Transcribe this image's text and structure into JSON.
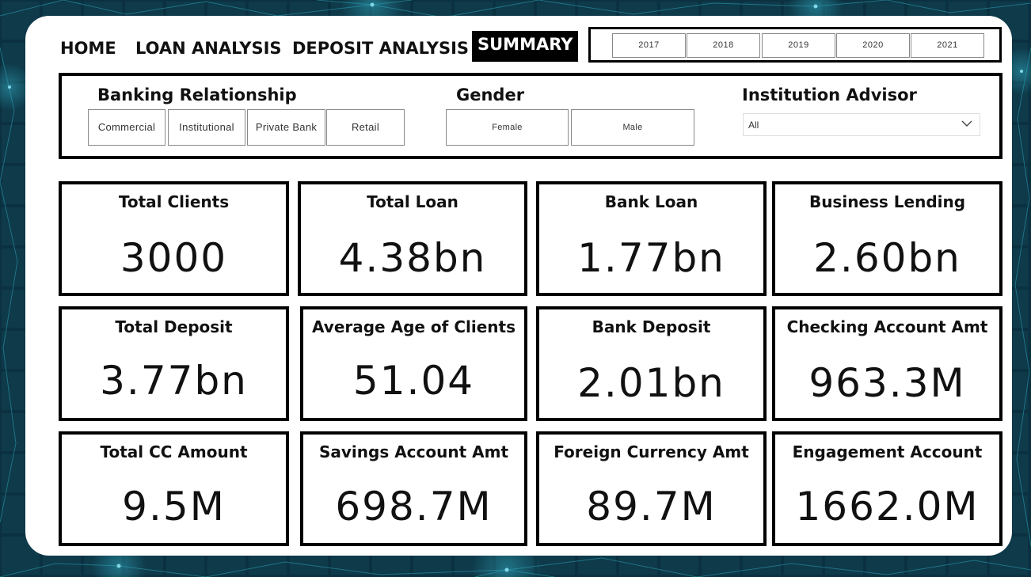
{
  "nav": {
    "home": "HOME",
    "loan_analysis": "LOAN ANALYSIS",
    "deposit_analysis": "DEPOSIT ANALYSIS",
    "summary": "SUMMARY"
  },
  "years": [
    "2017",
    "2018",
    "2019",
    "2020",
    "2021"
  ],
  "filters": {
    "banking_relationship": {
      "title": "Banking Relationship",
      "options": [
        "Commercial",
        "Institutional",
        "Private Bank",
        "Retail"
      ]
    },
    "gender": {
      "title": "Gender",
      "options": [
        "Female",
        "Male"
      ]
    },
    "institution_advisor": {
      "title": "Institution Advisor",
      "value": "All",
      "icon": "chevron-down-icon"
    }
  },
  "kpis": [
    {
      "title": "Total Clients",
      "value": "3000"
    },
    {
      "title": "Total Loan",
      "value": "4.38bn"
    },
    {
      "title": "Bank Loan",
      "value": "1.77bn"
    },
    {
      "title": "Business Lending",
      "value": "2.60bn"
    },
    {
      "title": "Total Deposit",
      "value": "3.77bn"
    },
    {
      "title": "Average Age of Clients",
      "value": "51.04"
    },
    {
      "title": "Bank Deposit",
      "value": "2.01bn"
    },
    {
      "title": "Checking Account Amt",
      "value": "963.3M"
    },
    {
      "title": "Total CC Amount",
      "value": "9.5M"
    },
    {
      "title": "Savings Account Amt",
      "value": "698.7M"
    },
    {
      "title": "Foreign Currency Amt",
      "value": "89.7M"
    },
    {
      "title": "Engagement Account",
      "value": "1662.0M"
    }
  ],
  "colors": {
    "background": "#0b3140",
    "network_lines": "#2fa3b8",
    "card": "#ffffff",
    "border": "#000000",
    "active_tab_bg": "#000000",
    "active_tab_text": "#ffffff"
  }
}
